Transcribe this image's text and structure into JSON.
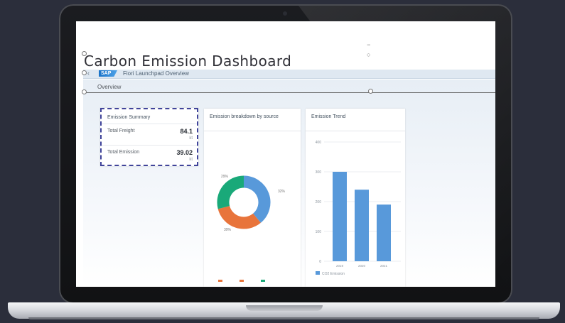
{
  "dashboard": {
    "title": "Carbon Emission Dashboard",
    "app_title": "Fiori Launchpad Overview",
    "page_label": "Overview",
    "logo_text": "SAP",
    "back_glyph": "‹",
    "corner_glyphs": [
      "−",
      "○"
    ]
  },
  "summary_card": {
    "title": "Emission Summary",
    "rows": [
      {
        "label": "Total Freight",
        "value": "84.1",
        "unit": "kt"
      },
      {
        "label": "Total Emission",
        "value": "39.02",
        "unit": "kt"
      }
    ]
  },
  "donut_card": {
    "title": "Emission breakdown by source",
    "labels": [
      "32%",
      "39%",
      "29%"
    ],
    "colors": [
      "#5899da",
      "#e8743b",
      "#19a979"
    ]
  },
  "bar_card": {
    "title": "Emission Trend",
    "series_label": "CO2 Emission",
    "color": "#5899da"
  },
  "chart_data": [
    {
      "type": "pie",
      "title": "Emission breakdown by source",
      "values": [
        39,
        32,
        29
      ],
      "colors": [
        "#5899da",
        "#e8743b",
        "#19a979"
      ]
    },
    {
      "type": "bar",
      "title": "Emission Trend",
      "categories": [
        "2019",
        "2020",
        "2021"
      ],
      "series": [
        {
          "name": "CO2 Emission",
          "values": [
            300,
            240,
            190
          ]
        }
      ],
      "ylim": [
        0,
        400
      ],
      "yticks": [
        "400",
        "300",
        "200",
        "100",
        "0"
      ],
      "grid": true,
      "legend": "bottom-left"
    }
  ]
}
